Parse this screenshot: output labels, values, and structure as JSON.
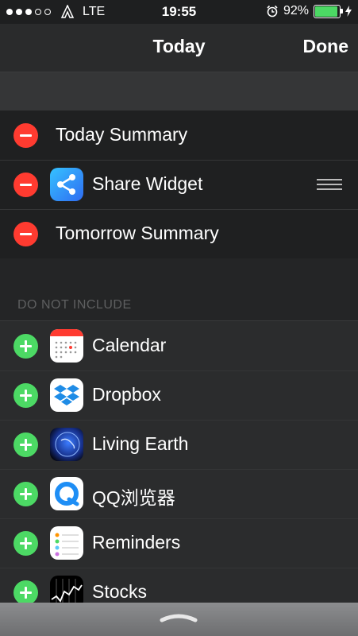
{
  "status_bar": {
    "network": "LTE",
    "time": "19:55",
    "battery_percent": "92%",
    "battery_level": 0.92,
    "signal_bars_filled": 3,
    "signal_bars_total": 5
  },
  "nav": {
    "title": "Today",
    "done_label": "Done"
  },
  "included": [
    {
      "label": "Today Summary",
      "has_icon": false
    },
    {
      "label": "Share Widget",
      "icon": "share-icon",
      "reorderable": true
    },
    {
      "label": "Tomorrow Summary",
      "has_icon": false
    }
  ],
  "exclude_header": "DO NOT INCLUDE",
  "excluded": [
    {
      "label": "Calendar",
      "icon": "calendar-icon"
    },
    {
      "label": "Dropbox",
      "icon": "dropbox-icon"
    },
    {
      "label": "Living Earth",
      "icon": "earth-icon"
    },
    {
      "label": "QQ浏览器",
      "icon": "qq-browser-icon"
    },
    {
      "label": "Reminders",
      "icon": "reminders-icon"
    },
    {
      "label": "Stocks",
      "icon": "stocks-icon"
    }
  ],
  "colors": {
    "remove": "#ff3b30",
    "add": "#4cd964",
    "battery": "#4cd964"
  }
}
